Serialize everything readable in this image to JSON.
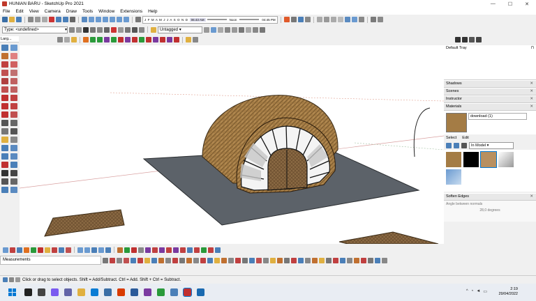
{
  "window": {
    "title": "HUNIAN BARU - SketchUp Pro 2021",
    "minimize": "—",
    "maximize": "☐",
    "close": "✕"
  },
  "menu": [
    "File",
    "Edit",
    "View",
    "Camera",
    "Draw",
    "Tools",
    "Window",
    "Extensions",
    "Help"
  ],
  "toolbar": {
    "type_label": "Type: <undefined>",
    "tag_value": "Untagged",
    "months": "J F M A M J J A S O N D",
    "time1": "06:43 AM",
    "noon": "Noon",
    "time2": "04:45 PM"
  },
  "left_palette": {
    "title": "Larg..."
  },
  "tray": {
    "title": "Default Tray",
    "sections": [
      "Shadows",
      "Scenes",
      "Instructor",
      "Materials"
    ],
    "material_name": "download (1)",
    "tabs": [
      "Select",
      "Edit"
    ],
    "library": "In Model",
    "soften": "Soften Edges",
    "soften_label": "Angle between normals",
    "soften_value": "28,0  degrees"
  },
  "measurements_label": "Measurements",
  "status_text": "Click or drag to select objects. Shift = Add/Subtract. Ctrl = Add. Shift + Ctrl = Subtract.",
  "clock": {
    "time": "2:19",
    "date": "29/04/2022"
  },
  "colors": {
    "ground": "#5c6269",
    "thatch": "#a47c45",
    "accent": "#0078d4"
  }
}
